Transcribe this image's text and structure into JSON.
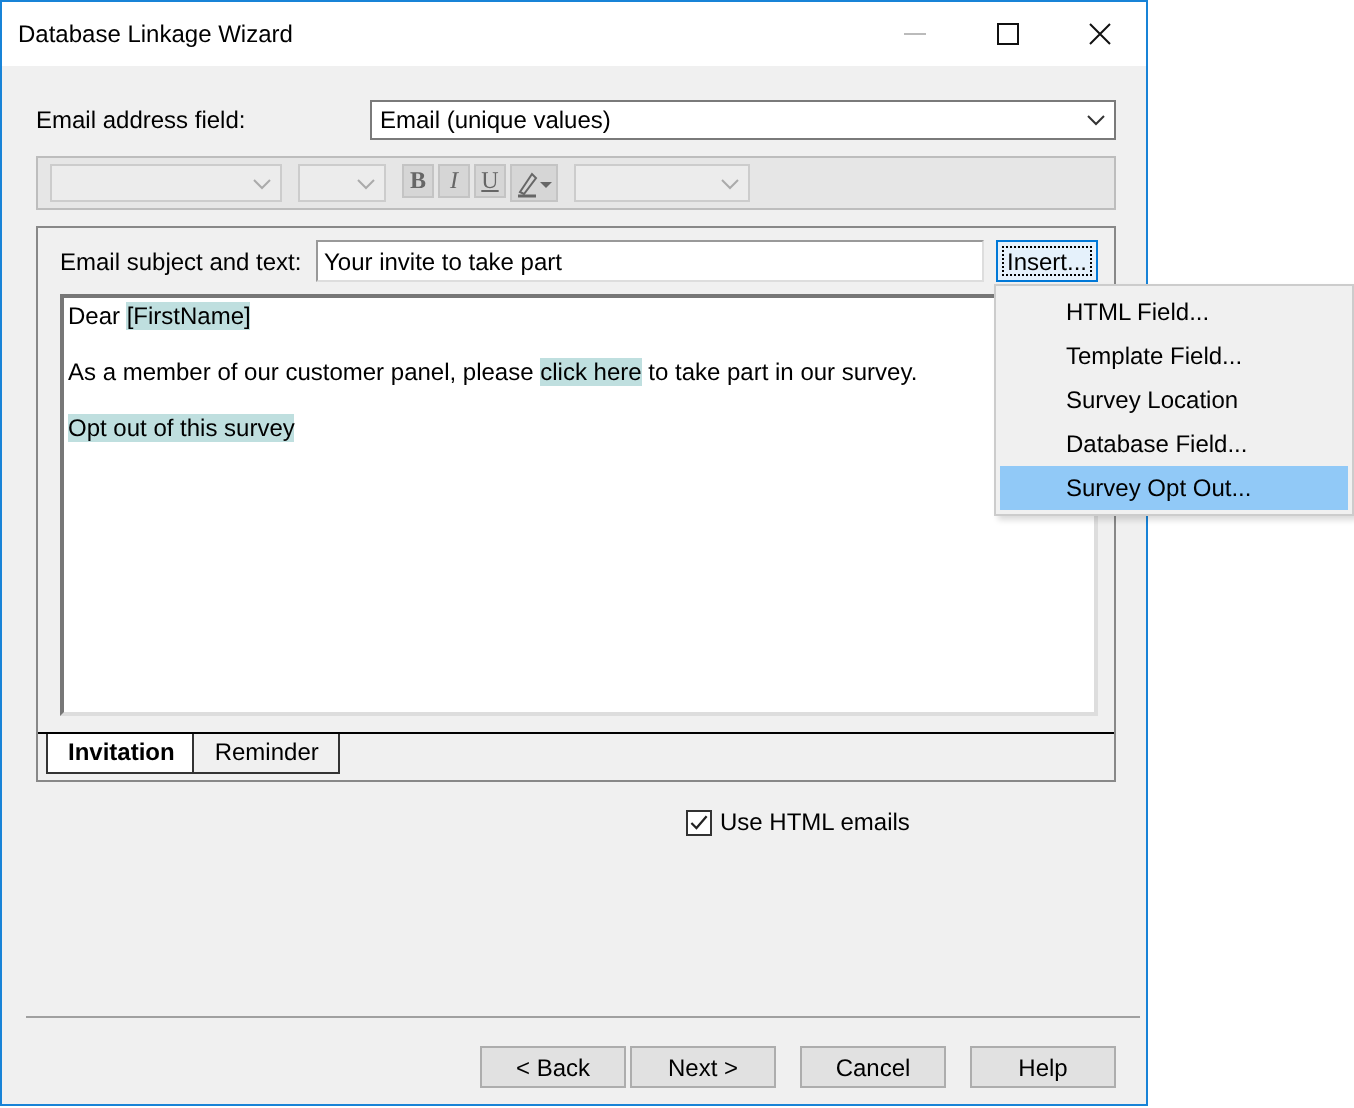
{
  "window": {
    "title": "Database Linkage Wizard"
  },
  "email_field": {
    "label": "Email address field:",
    "value": "Email (unique values)"
  },
  "format_toolbar": {
    "buttons": [
      {
        "kind": "bold",
        "label": "B",
        "disabled": true
      },
      {
        "kind": "italic",
        "label": "I",
        "disabled": true
      },
      {
        "kind": "underline",
        "label": "U",
        "disabled": true
      },
      {
        "kind": "color"
      }
    ]
  },
  "subject": {
    "label": "Email subject and text:",
    "value": "Your invite to take part"
  },
  "insert_button": {
    "label": "Insert..."
  },
  "body": [
    [
      {
        "kind": "text",
        "text": "Dear "
      },
      {
        "kind": "field",
        "text": "[FirstName]"
      }
    ],
    [
      {
        "kind": "text",
        "text": "As a member of our customer panel, please "
      },
      {
        "kind": "link",
        "text": "click here"
      },
      {
        "kind": "text",
        "text": " to take part in our survey."
      }
    ],
    [
      {
        "kind": "link",
        "text": "Opt out of this survey"
      }
    ]
  ],
  "tabs": [
    {
      "label": "Invitation",
      "selected": true
    },
    {
      "label": "Reminder",
      "selected": false
    }
  ],
  "html_emails": {
    "label": "Use HTML emails",
    "checked": true
  },
  "buttons": [
    "< Back",
    "Next >",
    "Cancel",
    "Help"
  ],
  "insert_menu": [
    {
      "label": "HTML Field...",
      "selected": false
    },
    {
      "label": "Template Field...",
      "selected": false
    },
    {
      "label": "Survey Location",
      "selected": false
    },
    {
      "label": "Database Field...",
      "selected": false
    },
    {
      "label": "Survey Opt Out...",
      "selected": true
    }
  ]
}
